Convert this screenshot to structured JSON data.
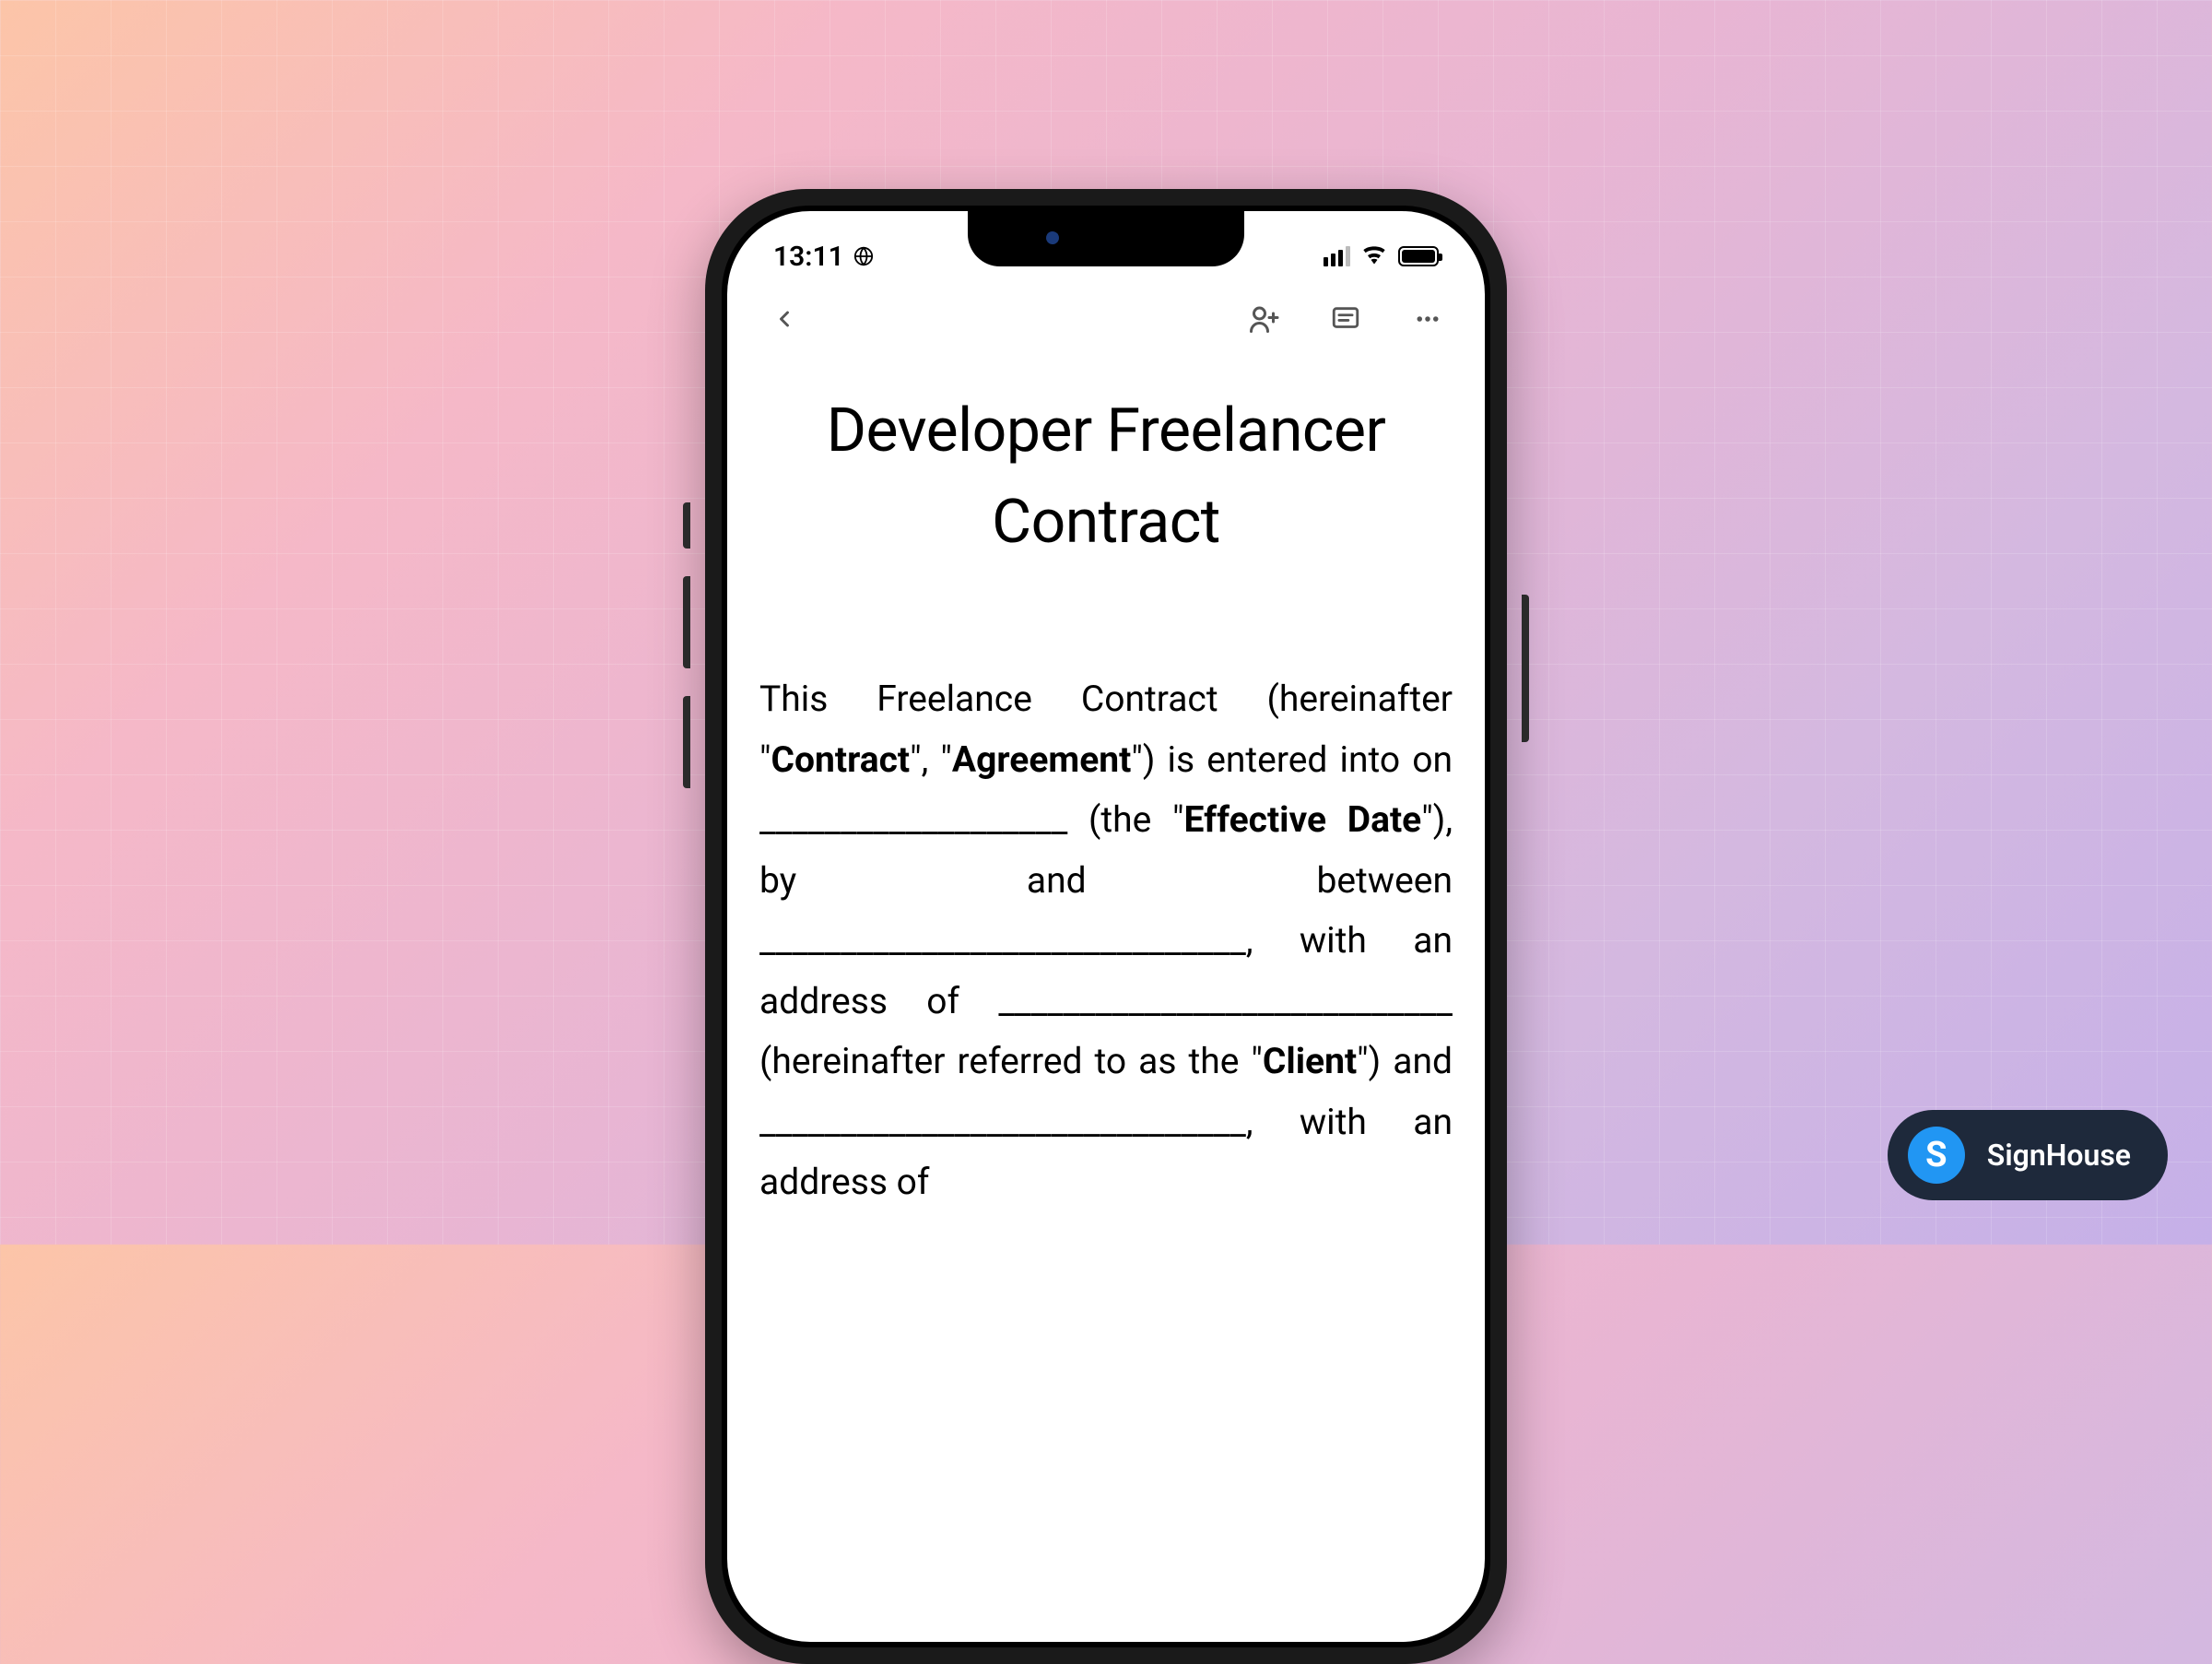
{
  "status": {
    "time": "13:11"
  },
  "document": {
    "title": "Developer Freelancer Contract",
    "body_html": "This Freelance Contract (hereinafter \"<b>Contract</b>\", \"<b>Agreement</b>\") is entered into on ___________________ (the \"<b>Effective Date</b>\"), by and between ______________________________, with an address of ____________________________ (hereinafter referred to as the \"<b>Client</b>\") and ______________________________, with an address of"
  },
  "brand": {
    "logo_letter": "S",
    "name": "SignHouse"
  }
}
